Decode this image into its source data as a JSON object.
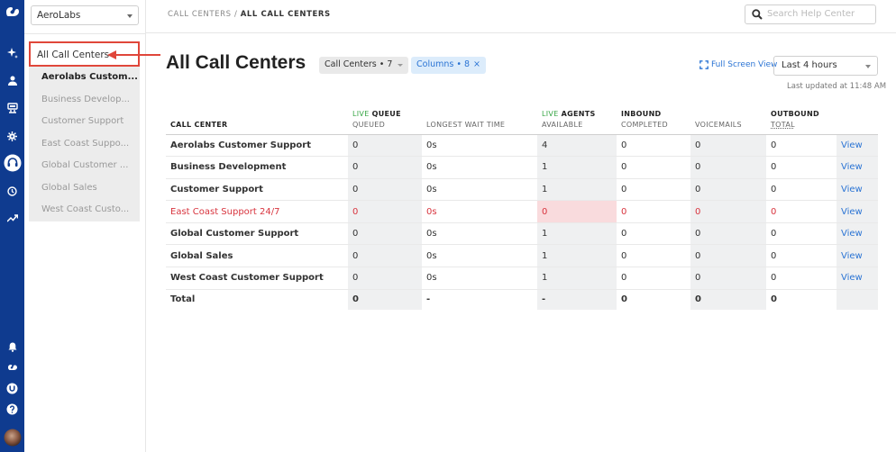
{
  "org": {
    "selected": "AeroLabs"
  },
  "nav": {
    "all_label": "All Call Centers",
    "items": [
      {
        "label": "Aerolabs Custom...",
        "active": true
      },
      {
        "label": "Business Develop..."
      },
      {
        "label": "Customer Support"
      },
      {
        "label": "East Coast Suppo..."
      },
      {
        "label": "Global Customer ..."
      },
      {
        "label": "Global Sales"
      },
      {
        "label": "West Coast Custo..."
      }
    ]
  },
  "breadcrumb": {
    "parent": "CALL CENTERS",
    "sep": " / ",
    "current": "ALL CALL CENTERS"
  },
  "help_search": {
    "placeholder": "Search Help Center"
  },
  "header": {
    "title": "All Call Centers",
    "call_centers_chip": "Call Centers • 7",
    "columns_chip": "Columns • 8",
    "columns_chip_remove": "×",
    "fullscreen_label": "Full Screen View",
    "time_range": "Last 4 hours",
    "last_updated": "Last updated at 11:48 AM"
  },
  "table": {
    "headers": {
      "call_center": "CALL CENTER",
      "live_prefix": "LIVE",
      "queue_group": "QUEUE",
      "queued": "QUEUED",
      "longest_wait": "LONGEST WAIT TIME",
      "agents_group": "AGENTS",
      "available": "AVAILABLE",
      "inbound_group": "INBOUND",
      "completed": "COMPLETED",
      "voicemails": "VOICEMAILS",
      "outbound_group": "OUTBOUND",
      "total": "TOTAL"
    },
    "rows": [
      {
        "name": "Aerolabs Customer Support",
        "queued": "0",
        "wait": "0s",
        "available": "4",
        "completed": "0",
        "voicemails": "0",
        "outbound": "0",
        "action": "View"
      },
      {
        "name": "Business Development",
        "queued": "0",
        "wait": "0s",
        "available": "1",
        "completed": "0",
        "voicemails": "0",
        "outbound": "0",
        "action": "View"
      },
      {
        "name": "Customer Support",
        "queued": "0",
        "wait": "0s",
        "available": "1",
        "completed": "0",
        "voicemails": "0",
        "outbound": "0",
        "action": "View"
      },
      {
        "name": "East Coast Support 24/7",
        "queued": "0",
        "wait": "0s",
        "available": "0",
        "completed": "0",
        "voicemails": "0",
        "outbound": "0",
        "action": "View",
        "alert": true
      },
      {
        "name": "Global Customer Support",
        "queued": "0",
        "wait": "0s",
        "available": "1",
        "completed": "0",
        "voicemails": "0",
        "outbound": "0",
        "action": "View"
      },
      {
        "name": "Global Sales",
        "queued": "0",
        "wait": "0s",
        "available": "1",
        "completed": "0",
        "voicemails": "0",
        "outbound": "0",
        "action": "View"
      },
      {
        "name": "West Coast Customer Support",
        "queued": "0",
        "wait": "0s",
        "available": "1",
        "completed": "0",
        "voicemails": "0",
        "outbound": "0",
        "action": "View"
      }
    ],
    "total_row": {
      "name": "Total",
      "queued": "0",
      "wait": "-",
      "available": "-",
      "completed": "0",
      "voicemails": "0",
      "outbound": "0"
    }
  },
  "colors": {
    "rail": "#0f3b8f",
    "accent": "#2b74d4",
    "alert": "#d8343e",
    "live": "#3aa748",
    "annotation": "#e0463a"
  }
}
